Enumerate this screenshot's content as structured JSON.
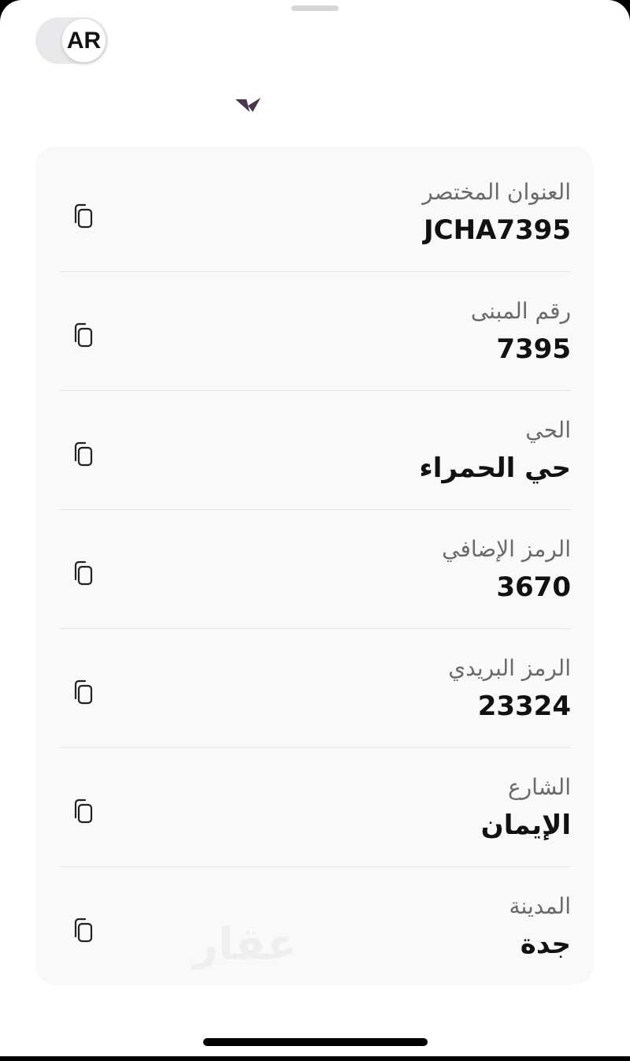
{
  "language_toggle": {
    "label": "AR"
  },
  "address": {
    "rows": [
      {
        "label": "العنوان المختصر",
        "value": "JCHA7395"
      },
      {
        "label": "رقم المبنى",
        "value": "7395"
      },
      {
        "label": "الحي",
        "value": "حي الحمراء"
      },
      {
        "label": "الرمز الإضافي",
        "value": "3670"
      },
      {
        "label": "الرمز البريدي",
        "value": "23324"
      },
      {
        "label": "الشارع",
        "value": "الإيمان"
      },
      {
        "label": "المدينة",
        "value": "جدة"
      }
    ]
  },
  "icons": {
    "copy": "copy-icon"
  },
  "colors": {
    "card_background": "#f9f9f9",
    "label_text": "#6a6a6a",
    "value_text": "#111111",
    "logo": "#4a3550"
  }
}
